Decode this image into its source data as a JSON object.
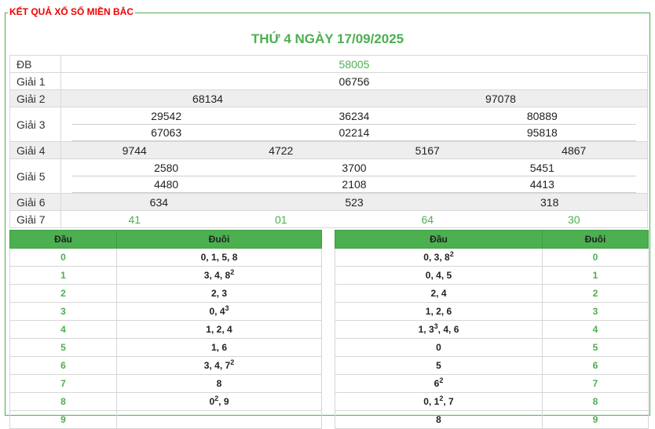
{
  "title": "KẾT QUẢ XỔ SỐ MIỀN BẮC",
  "date": "THỨ 4 NGÀY 17/09/2025",
  "prizes": {
    "db": {
      "label": "ĐB",
      "values": [
        "58005"
      ]
    },
    "g1": {
      "label": "Giải 1",
      "values": [
        "06756"
      ]
    },
    "g2": {
      "label": "Giải 2",
      "values": [
        "68134",
        "97078"
      ]
    },
    "g3": {
      "label": "Giải 3",
      "rows": [
        [
          "29542",
          "36234",
          "80889"
        ],
        [
          "67063",
          "02214",
          "95818"
        ]
      ]
    },
    "g4": {
      "label": "Giải 4",
      "values": [
        "9744",
        "4722",
        "5167",
        "4867"
      ]
    },
    "g5": {
      "label": "Giải 5",
      "rows": [
        [
          "2580",
          "3700",
          "5451"
        ],
        [
          "4480",
          "2108",
          "4413"
        ]
      ]
    },
    "g6": {
      "label": "Giải 6",
      "values": [
        "634",
        "523",
        "318"
      ]
    },
    "g7": {
      "label": "Giải 7",
      "values": [
        "41",
        "01",
        "64",
        "30"
      ]
    }
  },
  "left_table": {
    "headers": [
      "Đầu",
      "Đuôi"
    ],
    "rows": [
      {
        "head": "0",
        "tail": "0, 1, 5, 8"
      },
      {
        "head": "1",
        "tail": "3, 4, 8²"
      },
      {
        "head": "2",
        "tail": "2, 3"
      },
      {
        "head": "3",
        "tail": "0, 4³"
      },
      {
        "head": "4",
        "tail": "1, 2, 4"
      },
      {
        "head": "5",
        "tail": "1, 6"
      },
      {
        "head": "6",
        "tail": "3, 4, 7²"
      },
      {
        "head": "7",
        "tail": "8"
      },
      {
        "head": "8",
        "tail": "0², 9"
      },
      {
        "head": "9",
        "tail": ""
      }
    ]
  },
  "right_table": {
    "headers": [
      "Đầu",
      "Đuôi"
    ],
    "rows": [
      {
        "head": "0, 3, 8²",
        "tail": "0"
      },
      {
        "head": "0, 4, 5",
        "tail": "1"
      },
      {
        "head": "2, 4",
        "tail": "2"
      },
      {
        "head": "1, 2, 6",
        "tail": "3"
      },
      {
        "head": "1, 3³, 4, 6",
        "tail": "4"
      },
      {
        "head": "0",
        "tail": "5"
      },
      {
        "head": "5",
        "tail": "6"
      },
      {
        "head": "6²",
        "tail": "7"
      },
      {
        "head": "0, 1², 7",
        "tail": "8"
      },
      {
        "head": "8",
        "tail": "9"
      }
    ]
  },
  "colors": {
    "accent": "#4caf50",
    "title_red": "#ee0000",
    "row_gray": "#eeeeee"
  }
}
